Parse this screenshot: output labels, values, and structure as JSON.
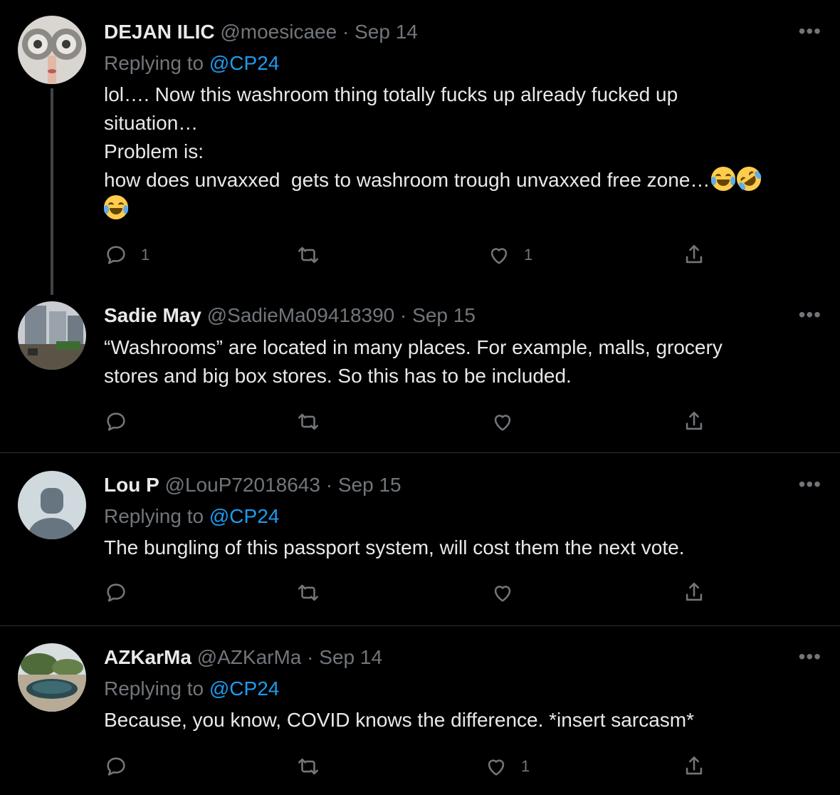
{
  "tweets": [
    {
      "name": "DEJAN ILIC",
      "handle": "@moesicaee",
      "date": "Sep 14",
      "replying_prefix": "Replying to ",
      "replying_to": "@CP24",
      "lines": [
        "lol…. Now this washroom thing totally fucks up already fucked up",
        "situation…",
        "Problem is:",
        "how does unvaxxed  gets to washroom trough unvaxxed free zone…"
      ],
      "emojis": [
        "face-with-tears-of-joy",
        "rolling-on-the-floor-laughing",
        "face-with-tears-of-joy"
      ],
      "reply_count": "1",
      "retweet_count": "",
      "like_count": "1",
      "more": "•••"
    },
    {
      "name": "Sadie May",
      "handle": "@SadieMa09418390",
      "date": "Sep 15",
      "lines": [
        "“Washrooms” are located in many places. For example, malls, grocery",
        "stores and big box stores. So this has to be included."
      ],
      "reply_count": "",
      "retweet_count": "",
      "like_count": "",
      "more": "•••"
    },
    {
      "name": "Lou P",
      "handle": "@LouP72018643",
      "date": "Sep 15",
      "replying_prefix": "Replying to ",
      "replying_to": "@CP24",
      "lines": [
        "The bungling of this passport system, will cost them the next vote."
      ],
      "reply_count": "",
      "retweet_count": "",
      "like_count": "",
      "more": "•••"
    },
    {
      "name": "AZKarMa",
      "handle": "@AZKarMa",
      "date": "Sep 14",
      "replying_prefix": "Replying to ",
      "replying_to": "@CP24",
      "lines": [
        "Because, you know, COVID knows the difference. *insert sarcasm*"
      ],
      "reply_count": "",
      "retweet_count": "",
      "like_count": "1",
      "more": "•••"
    }
  ],
  "separator": " · ",
  "colors": {
    "background": "#000000",
    "text": "#e7e9ea",
    "muted": "#71767b",
    "link": "#1d9bf0",
    "divider": "#2f3336"
  },
  "icons": [
    "reply-icon",
    "retweet-icon",
    "like-icon",
    "share-icon",
    "more-icon",
    "default-avatar-icon"
  ]
}
